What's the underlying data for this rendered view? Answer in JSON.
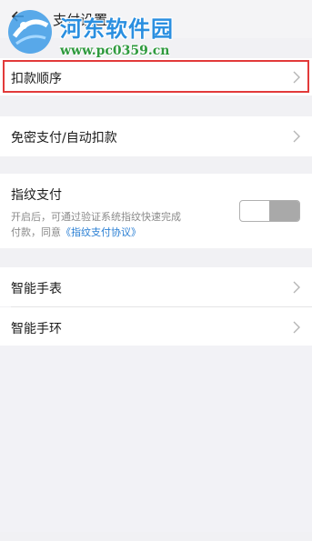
{
  "header": {
    "title": "支付设置",
    "back_icon": "back-arrow-icon"
  },
  "watermark": {
    "title": "河东软件园",
    "url": "www.pc0359.cn"
  },
  "settings": {
    "payment_order": "扣款顺序",
    "password_free": "免密支付/自动扣款",
    "fingerprint": {
      "label": "指纹支付",
      "desc_line1": "开启后，可通过验证系统指纹快速完成",
      "desc_line2_prefix": "付款，同意",
      "agreement_link": "《指纹支付协议》",
      "enabled": false
    },
    "smart_watch": "智能手表",
    "smart_band": "智能手环"
  },
  "colors": {
    "highlight": "#e23a3a",
    "link": "#2a7fd4",
    "watermark_blue": "#2a8fe0",
    "watermark_green": "#2f9a3e"
  }
}
